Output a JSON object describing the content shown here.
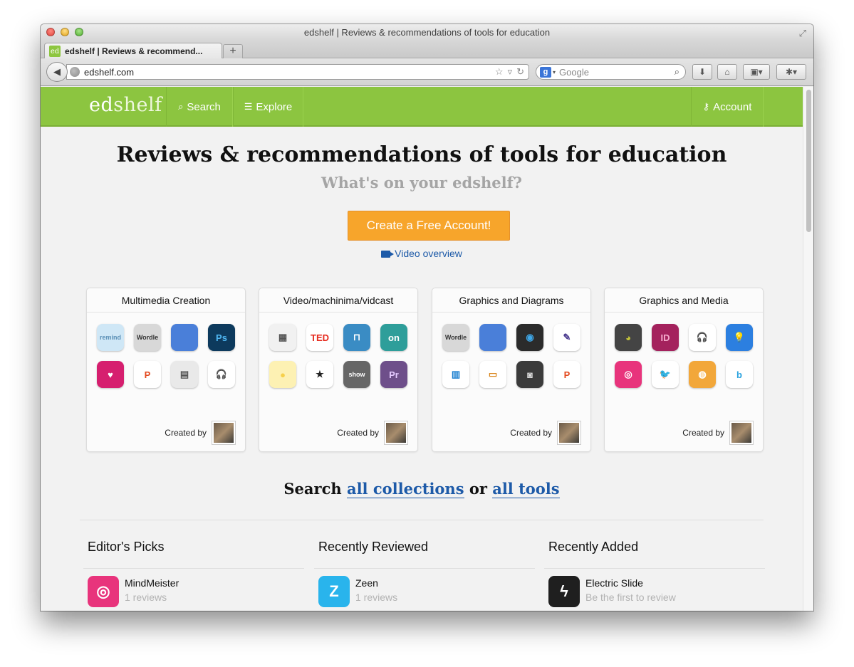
{
  "window": {
    "title": "edshelf | Reviews & recommendations of tools for education"
  },
  "tab": {
    "label": "edshelf | Reviews & recommend...",
    "favicon": "ed",
    "new_tab": "+"
  },
  "toolbar": {
    "url": "edshelf.com",
    "search_placeholder": "Google",
    "search_engine": "g"
  },
  "header": {
    "logo_ed": "ed",
    "logo_shelf": "shelf",
    "nav": [
      {
        "label": "Search",
        "icon": "search-icon"
      },
      {
        "label": "Explore",
        "icon": "list-icon"
      }
    ],
    "account": "Account",
    "color": "#8cc540"
  },
  "hero": {
    "headline": "Reviews & recommendations of tools for education",
    "subhead": "What's on your edshelf?",
    "cta": "Create a Free Account!",
    "video_link": "Video overview",
    "cta_color": "#f7a52b"
  },
  "collections": [
    {
      "title": "Multimedia Creation",
      "created_by": "Created by",
      "icons": [
        {
          "text": "remind",
          "bg": "#cfe7f6",
          "fg": "#5a8fb6"
        },
        {
          "text": "Wordle",
          "bg": "#d8d8d8",
          "fg": "#333333"
        },
        {
          "text": "",
          "bg": "#4a7fd9",
          "fg": "#ffffff"
        },
        {
          "text": "Ps",
          "bg": "#0d3a5d",
          "fg": "#4fb7f3"
        },
        {
          "text": "♥",
          "bg": "#d61f6f",
          "fg": "#ffffff"
        },
        {
          "text": "P",
          "bg": "#ffffff",
          "fg": "#e34a1f"
        },
        {
          "text": "▤",
          "bg": "#e9e9e9",
          "fg": "#555555"
        },
        {
          "text": "🎧",
          "bg": "#ffffff",
          "fg": "#1d3f9a"
        }
      ]
    },
    {
      "title": "Video/machinima/vidcast",
      "created_by": "Created by",
      "icons": [
        {
          "text": "▦",
          "bg": "#f1f1f1",
          "fg": "#555555"
        },
        {
          "text": "TED",
          "bg": "#ffffff",
          "fg": "#e62b1e"
        },
        {
          "text": "⊓",
          "bg": "#3a8cc4",
          "fg": "#ffffff"
        },
        {
          "text": "on",
          "bg": "#2e9e9a",
          "fg": "#ffffff"
        },
        {
          "text": "●",
          "bg": "#fdf1b3",
          "fg": "#f6d04a"
        },
        {
          "text": "★",
          "bg": "#ffffff",
          "fg": "#222222"
        },
        {
          "text": "show",
          "bg": "#666666",
          "fg": "#ffffff"
        },
        {
          "text": "Pr",
          "bg": "#6e4f8a",
          "fg": "#e4c9ff"
        }
      ]
    },
    {
      "title": "Graphics and Diagrams",
      "created_by": "Created by",
      "icons": [
        {
          "text": "Wordle",
          "bg": "#d8d8d8",
          "fg": "#333333"
        },
        {
          "text": "",
          "bg": "#4a7fd9",
          "fg": "#ffffff"
        },
        {
          "text": "◉",
          "bg": "#2b2b2b",
          "fg": "#3ea7e8"
        },
        {
          "text": "✎",
          "bg": "#ffffff",
          "fg": "#4b3b8f"
        },
        {
          "text": "▥",
          "bg": "#ffffff",
          "fg": "#1a7fd0"
        },
        {
          "text": "▭",
          "bg": "#ffffff",
          "fg": "#d9841a"
        },
        {
          "text": "◙",
          "bg": "#3b3b3b",
          "fg": "#dddddd"
        },
        {
          "text": "P",
          "bg": "#ffffff",
          "fg": "#e34a1f"
        }
      ]
    },
    {
      "title": "Graphics and Media",
      "created_by": "Created by",
      "icons": [
        {
          "text": "◕",
          "bg": "#444444",
          "fg": "#c4c43a"
        },
        {
          "text": "ID",
          "bg": "#a4225d",
          "fg": "#f4a9cb"
        },
        {
          "text": "🎧",
          "bg": "#ffffff",
          "fg": "#1d3f9a"
        },
        {
          "text": "💡",
          "bg": "#2c7fe0",
          "fg": "#ffffff"
        },
        {
          "text": "◎",
          "bg": "#e8347c",
          "fg": "#ffffff"
        },
        {
          "text": "🐦",
          "bg": "#ffffff",
          "fg": "#c56f15"
        },
        {
          "text": "◍",
          "bg": "#f2a73a",
          "fg": "#ffffff"
        },
        {
          "text": "b",
          "bg": "#ffffff",
          "fg": "#2ba3df"
        }
      ]
    }
  ],
  "search_line": {
    "prefix": "Search",
    "link1": "all collections",
    "or": "or",
    "link2": "all tools"
  },
  "columns": [
    {
      "title": "Editor's Picks",
      "item": {
        "name": "MindMeister",
        "sub": "1 reviews",
        "icon_text": "◎",
        "icon_bg": "#e8347c"
      }
    },
    {
      "title": "Recently Reviewed",
      "item": {
        "name": "Zeen",
        "sub": "1 reviews",
        "icon_text": "Z",
        "icon_bg": "#29b4ec"
      }
    },
    {
      "title": "Recently Added",
      "item": {
        "name": "Electric Slide",
        "sub": "Be the first to review",
        "icon_text": "ϟ",
        "icon_bg": "#1f1f1f"
      }
    }
  ]
}
